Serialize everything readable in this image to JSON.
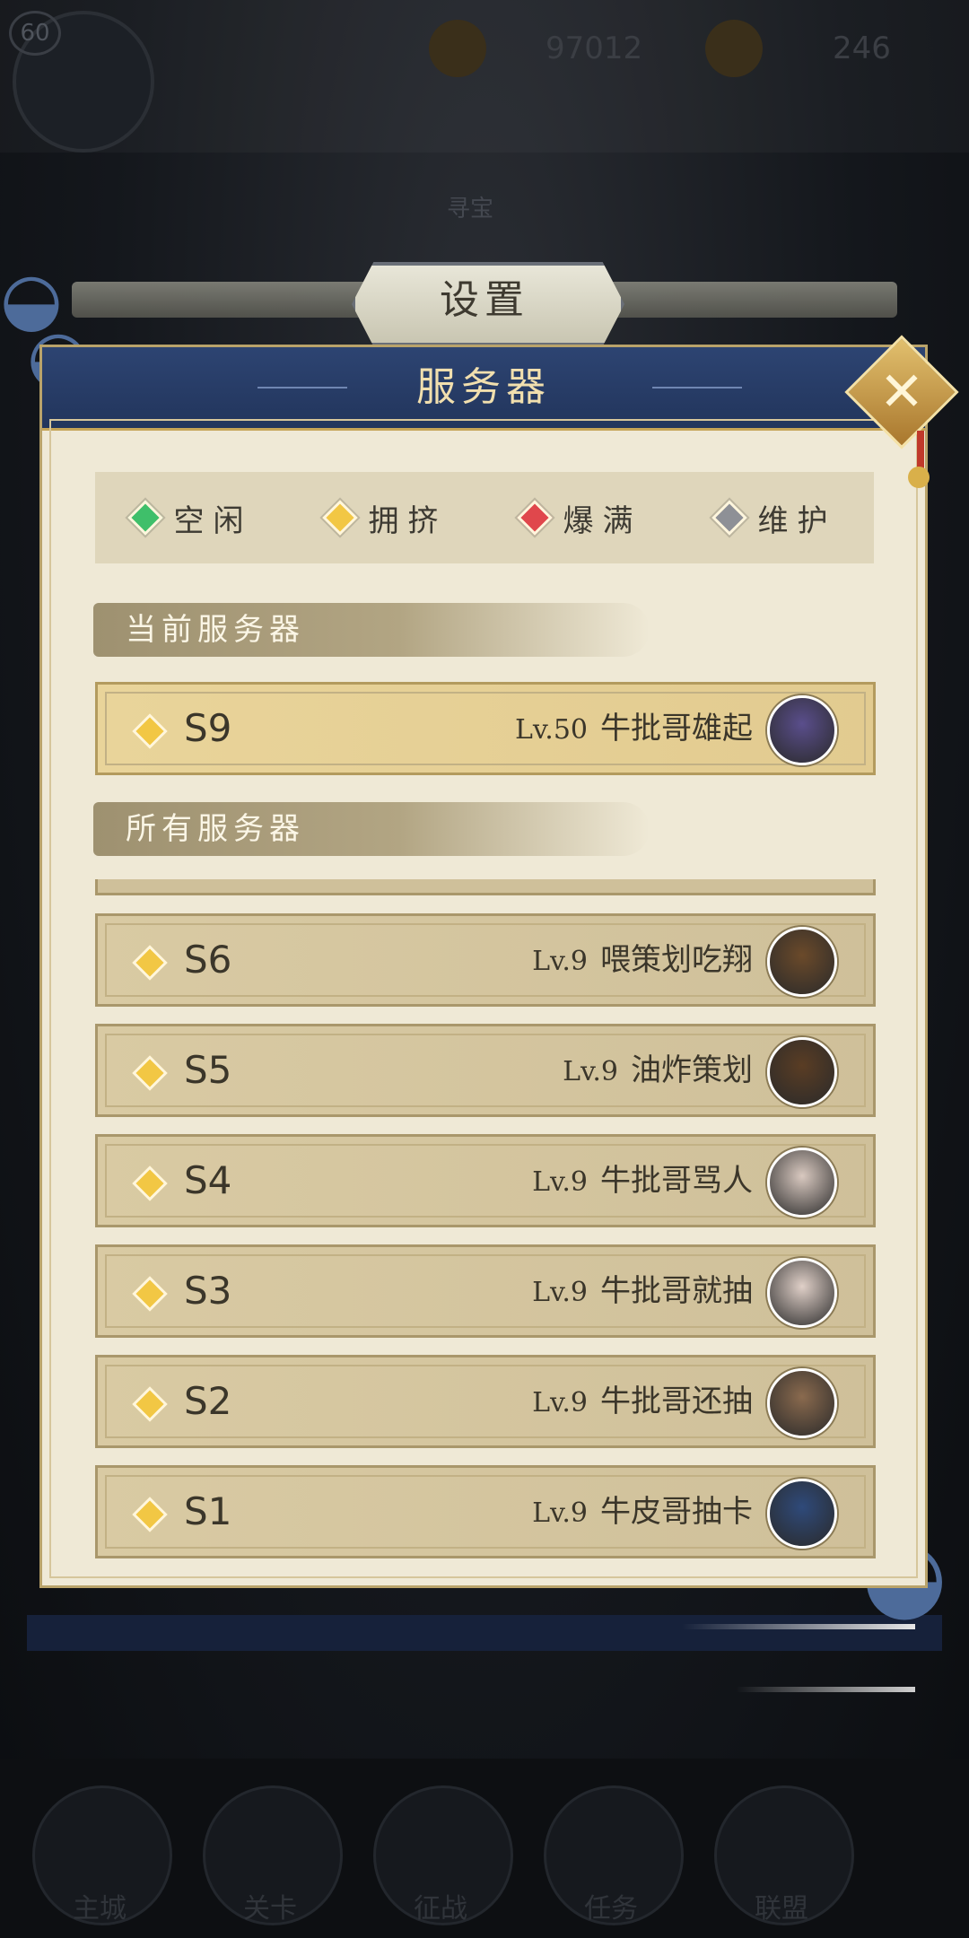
{
  "background": {
    "level_badge": "60",
    "currency_1": "97012",
    "currency_2": "246",
    "treasure_label": "寻宝",
    "nav": [
      "主城",
      "关卡",
      "征战",
      "任务",
      "联盟"
    ]
  },
  "settings_tab": {
    "label": "设置"
  },
  "panel": {
    "title": "服务器",
    "close_icon": "close-icon"
  },
  "legend": [
    {
      "label": "空闲",
      "color": "#3fbf6a"
    },
    {
      "label": "拥挤",
      "color": "#f2c744"
    },
    {
      "label": "爆满",
      "color": "#e0474c"
    },
    {
      "label": "维护",
      "color": "#8e9096"
    }
  ],
  "current_section": {
    "label": "当前服务器"
  },
  "current_server": {
    "server": "S9",
    "level": "Lv.50",
    "name": "牛批哥雄起",
    "status_color": "#f2c744",
    "avatar_color": "#5a4e8c"
  },
  "all_section": {
    "label": "所有服务器"
  },
  "servers": [
    {
      "server": "S6",
      "level": "Lv.9",
      "name": "喂策划吃翔",
      "avatar_color": "#6b4a2a"
    },
    {
      "server": "S5",
      "level": "Lv.9",
      "name": "油炸策划",
      "avatar_color": "#5a3d24"
    },
    {
      "server": "S4",
      "level": "Lv.9",
      "name": "牛批哥骂人",
      "avatar_color": "#d9c9c0"
    },
    {
      "server": "S3",
      "level": "Lv.9",
      "name": "牛批哥就抽",
      "avatar_color": "#e0d0c8"
    },
    {
      "server": "S2",
      "level": "Lv.9",
      "name": "牛批哥还抽",
      "avatar_color": "#8a6a4e"
    },
    {
      "server": "S1",
      "level": "Lv.9",
      "name": "牛皮哥抽卡",
      "avatar_color": "#2f4a7a"
    }
  ]
}
